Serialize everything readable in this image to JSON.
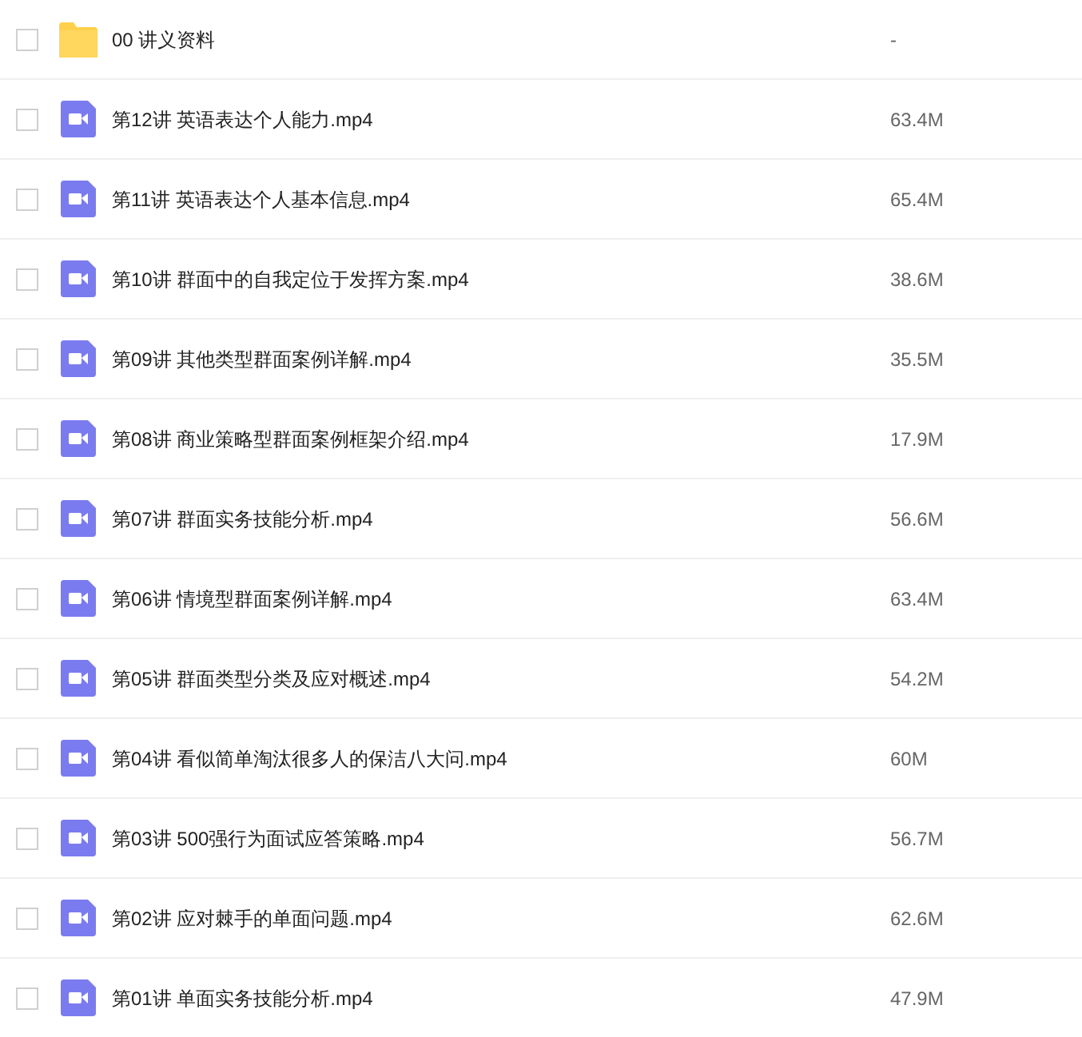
{
  "files": [
    {
      "kind": "folder",
      "checked": false,
      "name": "00 讲义资料",
      "size": "-"
    },
    {
      "kind": "video",
      "checked": false,
      "name": "第12讲 英语表达个人能力.mp4",
      "size": "63.4M"
    },
    {
      "kind": "video",
      "checked": false,
      "name": "第11讲 英语表达个人基本信息.mp4",
      "size": "65.4M"
    },
    {
      "kind": "video",
      "checked": false,
      "name": "第10讲 群面中的自我定位于发挥方案.mp4",
      "size": "38.6M"
    },
    {
      "kind": "video",
      "checked": false,
      "name": "第09讲 其他类型群面案例详解.mp4",
      "size": "35.5M"
    },
    {
      "kind": "video",
      "checked": false,
      "name": "第08讲 商业策略型群面案例框架介绍.mp4",
      "size": "17.9M"
    },
    {
      "kind": "video",
      "checked": false,
      "name": "第07讲 群面实务技能分析.mp4",
      "size": "56.6M"
    },
    {
      "kind": "video",
      "checked": false,
      "name": "第06讲 情境型群面案例详解.mp4",
      "size": "63.4M"
    },
    {
      "kind": "video",
      "checked": false,
      "name": "第05讲 群面类型分类及应对概述.mp4",
      "size": "54.2M"
    },
    {
      "kind": "video",
      "checked": false,
      "name": "第04讲 看似简单淘汰很多人的保洁八大问.mp4",
      "size": "60M"
    },
    {
      "kind": "video",
      "checked": false,
      "name": "第03讲 500强行为面试应答策略.mp4",
      "size": "56.7M"
    },
    {
      "kind": "video",
      "checked": false,
      "name": "第02讲 应对棘手的单面问题.mp4",
      "size": "62.6M"
    },
    {
      "kind": "video",
      "checked": false,
      "name": "第01讲 单面实务技能分析.mp4",
      "size": "47.9M"
    }
  ]
}
